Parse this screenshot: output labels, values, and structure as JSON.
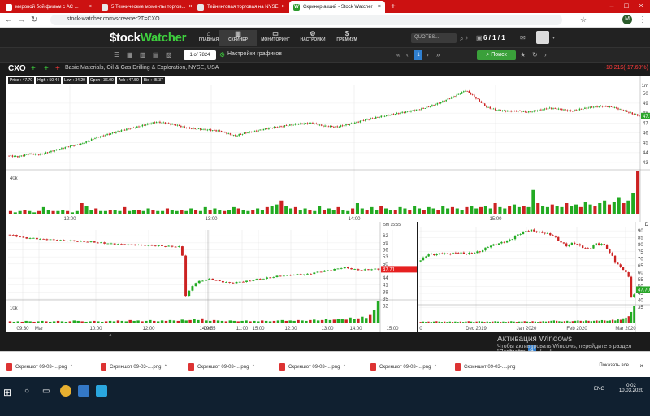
{
  "browser": {
    "tabs": [
      {
        "label": "мировой бой фильм с АС ...",
        "active": false
      },
      {
        "label": "5 Технические моменты торгов...",
        "active": false
      },
      {
        "label": "Тейнинговая торговая на NYSE",
        "active": false
      },
      {
        "label": "Скринер акций - Stock Watcher",
        "active": true
      }
    ],
    "url": "stock-watcher.com/screener?T=CXO"
  },
  "site": {
    "logo_prefix": "$tock",
    "logo_suffix": "Watcher",
    "menu": [
      "ГЛАВНАЯ",
      "СКРИНЕР",
      "МОНИТОРИНГ",
      "НАСТРОЙКИ",
      "ПРЕМИУМ"
    ],
    "quotes_placeholder": "QUOTES...",
    "counts": "6 / 1 / 1"
  },
  "toolbar": {
    "paging": "1 of 7824",
    "chart_settings": "Настройки графиков",
    "page_num": "1",
    "search": "Поиск"
  },
  "ticker": {
    "symbol": "CXO",
    "description": "Basic Materials, Oil & Gas Drilling & Exploration, NYSE, USA",
    "change": "-10.21$(-17.60%)"
  },
  "stats": [
    "Price : 47.70",
    "High : 50.44",
    "Low : 34.20",
    "Open : 36.00",
    "Ask : 47.50",
    "Bid : 45.37"
  ],
  "colors": {
    "up": "#22aa22",
    "down": "#cc2222",
    "accent": "#3aa03a",
    "brand_red": "#cc1111"
  },
  "chart_data": [
    {
      "type": "candlestick",
      "timeframe": "1m",
      "x_ticks": [
        "12:00",
        "13:00",
        "14:00",
        "15:00"
      ],
      "y_ticks": [
        43,
        44,
        45,
        46,
        47,
        48,
        49,
        50
      ],
      "ylim": [
        42.6,
        50.8
      ],
      "volume_label": "40k",
      "last_price": "47.70",
      "path": [
        [
          0,
          43.7
        ],
        [
          6,
          43.6
        ],
        [
          12,
          43.9
        ],
        [
          18,
          43.8
        ],
        [
          26,
          44.2
        ],
        [
          34,
          44.6
        ],
        [
          42,
          44.9
        ],
        [
          50,
          45.5
        ],
        [
          58,
          45.9
        ],
        [
          66,
          46.3
        ],
        [
          74,
          46.6
        ],
        [
          80,
          46.9
        ],
        [
          85,
          47.1
        ],
        [
          90,
          47.0
        ],
        [
          96,
          46.8
        ],
        [
          102,
          46.5
        ],
        [
          108,
          46.4
        ],
        [
          115,
          46.3
        ],
        [
          121,
          46.2
        ],
        [
          126,
          45.9
        ],
        [
          130,
          45.7
        ],
        [
          136,
          46.0
        ],
        [
          142,
          46.2
        ],
        [
          150,
          46.5
        ],
        [
          158,
          46.7
        ],
        [
          166,
          46.9
        ],
        [
          174,
          47.0
        ],
        [
          180,
          46.7
        ],
        [
          188,
          46.6
        ],
        [
          196,
          46.9
        ],
        [
          204,
          47.3
        ],
        [
          212,
          47.6
        ],
        [
          218,
          47.8
        ],
        [
          224,
          48.0
        ],
        [
          230,
          48.2
        ],
        [
          236,
          48.4
        ],
        [
          242,
          48.7
        ],
        [
          248,
          49.1
        ],
        [
          254,
          49.6
        ],
        [
          258,
          49.9
        ],
        [
          262,
          50.3
        ],
        [
          266,
          49.8
        ],
        [
          270,
          49.2
        ],
        [
          274,
          48.6
        ],
        [
          280,
          48.3
        ],
        [
          286,
          48.2
        ],
        [
          292,
          48.2
        ],
        [
          298,
          48.1
        ],
        [
          304,
          48.3
        ],
        [
          310,
          48.5
        ],
        [
          316,
          48.4
        ],
        [
          322,
          48.2
        ],
        [
          328,
          48.4
        ],
        [
          334,
          48.6
        ],
        [
          340,
          48.7
        ],
        [
          346,
          48.6
        ],
        [
          352,
          48.3
        ],
        [
          358,
          47.9
        ],
        [
          362,
          47.7
        ]
      ],
      "volume": [
        2,
        1,
        2,
        3,
        2,
        1,
        2,
        5,
        3,
        2,
        2,
        3,
        2,
        1,
        2,
        8,
        6,
        3,
        4,
        2,
        2,
        3,
        3,
        2,
        5,
        2,
        3,
        3,
        2,
        4,
        3,
        2,
        2,
        4,
        3,
        2,
        3,
        2,
        4,
        3,
        2,
        5,
        3,
        4,
        3,
        2,
        3,
        5,
        4,
        3,
        2,
        3,
        4,
        3,
        5,
        6,
        7,
        10,
        6,
        4,
        5,
        3,
        4,
        3,
        2,
        6,
        3,
        4,
        3,
        5,
        3,
        2,
        4,
        8,
        4,
        3,
        5,
        3,
        6,
        4,
        3,
        3,
        5,
        4,
        3,
        6,
        4,
        3,
        5,
        4,
        3,
        6,
        4,
        5,
        4,
        3,
        5,
        6,
        4,
        5,
        6,
        4,
        8,
        5,
        4,
        6,
        7,
        5,
        6,
        5,
        18,
        8,
        6,
        5,
        7,
        6,
        5,
        8,
        6,
        7,
        5,
        9,
        7,
        6,
        8,
        10,
        7,
        9,
        12,
        8,
        10,
        16,
        32
      ]
    },
    {
      "type": "candlestick",
      "timeframe": "5m",
      "header_time": "15:55",
      "x_ticks": [
        "09:30",
        "Mar",
        "10:00",
        "12:00",
        "14:00",
        "15:00",
        "09:55",
        "11:00",
        "12:00",
        "13:00",
        "14:00",
        "15:00"
      ],
      "y_ticks": [
        32,
        35,
        38,
        41,
        44,
        47,
        50,
        53,
        56,
        59,
        62
      ],
      "ylim": [
        30.5,
        64.5
      ],
      "volume_label": "10k",
      "last_price": "47.71",
      "path": [
        [
          0,
          62.5
        ],
        [
          5,
          62.2
        ],
        [
          10,
          61.6
        ],
        [
          15,
          61.2
        ],
        [
          20,
          60.9
        ],
        [
          25,
          61.0
        ],
        [
          30,
          60.6
        ],
        [
          40,
          60.4
        ],
        [
          50,
          60.0
        ],
        [
          60,
          59.9
        ],
        [
          70,
          59.6
        ],
        [
          80,
          59.4
        ],
        [
          90,
          59.0
        ],
        [
          100,
          58.6
        ],
        [
          110,
          58.3
        ],
        [
          120,
          58.2
        ],
        [
          130,
          58.0
        ],
        [
          140,
          57.8
        ],
        [
          150,
          57.6
        ],
        [
          160,
          57.4
        ],
        [
          165,
          57.3
        ],
        [
          168,
          57.6
        ],
        [
          171,
          36.0
        ],
        [
          174,
          37.5
        ],
        [
          177,
          40.0
        ],
        [
          180,
          41.5
        ],
        [
          185,
          42.6
        ],
        [
          190,
          43.2
        ],
        [
          195,
          43.6
        ],
        [
          200,
          43.1
        ],
        [
          205,
          42.5
        ],
        [
          210,
          42.2
        ],
        [
          215,
          41.9
        ],
        [
          220,
          42.1
        ],
        [
          225,
          42.4
        ],
        [
          230,
          42.6
        ],
        [
          235,
          42.9
        ],
        [
          240,
          43.4
        ],
        [
          245,
          43.7
        ],
        [
          250,
          44.0
        ],
        [
          255,
          44.3
        ],
        [
          260,
          44.7
        ],
        [
          265,
          44.9
        ],
        [
          270,
          45.1
        ],
        [
          275,
          45.3
        ],
        [
          280,
          45.5
        ],
        [
          285,
          45.4
        ],
        [
          290,
          45.7
        ],
        [
          295,
          46.1
        ],
        [
          300,
          46.6
        ],
        [
          305,
          47.0
        ],
        [
          310,
          47.3
        ],
        [
          315,
          47.6
        ],
        [
          320,
          48.1
        ],
        [
          325,
          48.5
        ],
        [
          330,
          48.1
        ],
        [
          335,
          47.6
        ],
        [
          340,
          47.4
        ],
        [
          345,
          47.5
        ],
        [
          350,
          47.7
        ],
        [
          355,
          47.8
        ],
        [
          360,
          47.7
        ]
      ],
      "volume": [
        3,
        2,
        3,
        2,
        4,
        3,
        2,
        3,
        4,
        3,
        2,
        3,
        4,
        3,
        2,
        3,
        5,
        4,
        3,
        2,
        3,
        4,
        3,
        2,
        3,
        4,
        3,
        5,
        4,
        3,
        6,
        4,
        5,
        3,
        4,
        6,
        4,
        3,
        5,
        4,
        6,
        5,
        4,
        7,
        5,
        6,
        8,
        6,
        10,
        5,
        4,
        6,
        5,
        4,
        3,
        5,
        4,
        3,
        4,
        5,
        3,
        4,
        3,
        5,
        4,
        3,
        4,
        5,
        6,
        4,
        5,
        4,
        6,
        5,
        4,
        6,
        7,
        5,
        6,
        8,
        6,
        7,
        9,
        8,
        7,
        12,
        9,
        10,
        14,
        11,
        18,
        30,
        50
      ]
    },
    {
      "type": "candlestick",
      "timeframe": "D",
      "x_ticks": [
        "0",
        "Dec 2019",
        "Jan 2020",
        "Feb 2020",
        "Mar 2020"
      ],
      "y_ticks": [
        35,
        40,
        45,
        50,
        55,
        60,
        65,
        70,
        75,
        80,
        85,
        90
      ],
      "ylim": [
        31,
        93
      ],
      "last_price": "47.70",
      "path": [
        [
          0,
          68
        ],
        [
          4,
          70
        ],
        [
          8,
          72
        ],
        [
          12,
          73.5
        ],
        [
          16,
          73.2
        ],
        [
          20,
          72.8
        ],
        [
          24,
          73.5
        ],
        [
          28,
          74
        ],
        [
          34,
          73.2
        ],
        [
          40,
          73.8
        ],
        [
          46,
          74.4
        ],
        [
          52,
          74.0
        ],
        [
          58,
          73.5
        ],
        [
          64,
          74.0
        ],
        [
          70,
          74.6
        ],
        [
          76,
          75.2
        ],
        [
          80,
          77
        ],
        [
          86,
          79
        ],
        [
          92,
          80
        ],
        [
          98,
          81
        ],
        [
          104,
          82
        ],
        [
          110,
          83
        ],
        [
          116,
          85
        ],
        [
          120,
          87
        ],
        [
          126,
          88.5
        ],
        [
          132,
          90
        ],
        [
          138,
          90.5
        ],
        [
          142,
          89.5
        ],
        [
          148,
          89
        ],
        [
          154,
          88.5
        ],
        [
          160,
          87.5
        ],
        [
          166,
          86
        ],
        [
          170,
          84
        ],
        [
          174,
          82
        ],
        [
          178,
          80.5
        ],
        [
          182,
          79
        ],
        [
          186,
          80.5
        ],
        [
          190,
          81.5
        ],
        [
          194,
          80.5
        ],
        [
          198,
          79
        ],
        [
          202,
          78
        ],
        [
          206,
          77
        ],
        [
          210,
          77.5
        ],
        [
          214,
          79
        ],
        [
          218,
          81
        ],
        [
          222,
          80
        ],
        [
          226,
          80.5
        ],
        [
          230,
          79
        ],
        [
          234,
          74
        ],
        [
          238,
          72
        ],
        [
          242,
          66
        ],
        [
          246,
          65
        ],
        [
          250,
          63
        ],
        [
          254,
          60
        ],
        [
          258,
          57
        ],
        [
          260,
          48
        ],
        [
          262,
          37
        ],
        [
          264,
          43
        ],
        [
          266,
          47.7
        ]
      ],
      "volume": [
        2,
        3,
        2,
        3,
        2,
        3,
        4,
        3,
        2,
        3,
        2,
        3,
        2,
        3,
        2,
        3,
        2,
        3,
        4,
        3,
        2,
        3,
        4,
        3,
        2,
        3,
        2,
        3,
        4,
        3,
        2,
        3,
        2,
        3,
        4,
        3,
        2,
        3,
        3,
        4,
        3,
        2,
        4,
        3,
        2,
        3,
        4,
        3,
        4,
        5,
        6,
        5,
        4,
        3,
        4,
        5,
        3,
        4,
        5,
        6,
        5,
        4,
        6,
        5,
        4,
        5,
        6,
        5,
        7,
        6,
        5,
        6,
        8,
        6,
        9,
        8,
        12,
        14,
        18,
        30,
        46
      ]
    }
  ],
  "downloads": [
    "Скриншот 09-03-....png",
    "Скриншот 09-03-....png",
    "Скриншот 09-03-....png",
    "Скриншот 09-03-....png",
    "Скриншот 09-03-....png",
    "Скриншот 09-03-....png"
  ],
  "show_all": "Показать все",
  "windows_watermark": {
    "title": "Активация Windows",
    "subtitle": "Чтобы активировать Windows, перейдите в раздел \"Параметры\"."
  },
  "taskbar": {
    "lang": "ENG",
    "time": "0:02",
    "date": "10.03.2020"
  }
}
